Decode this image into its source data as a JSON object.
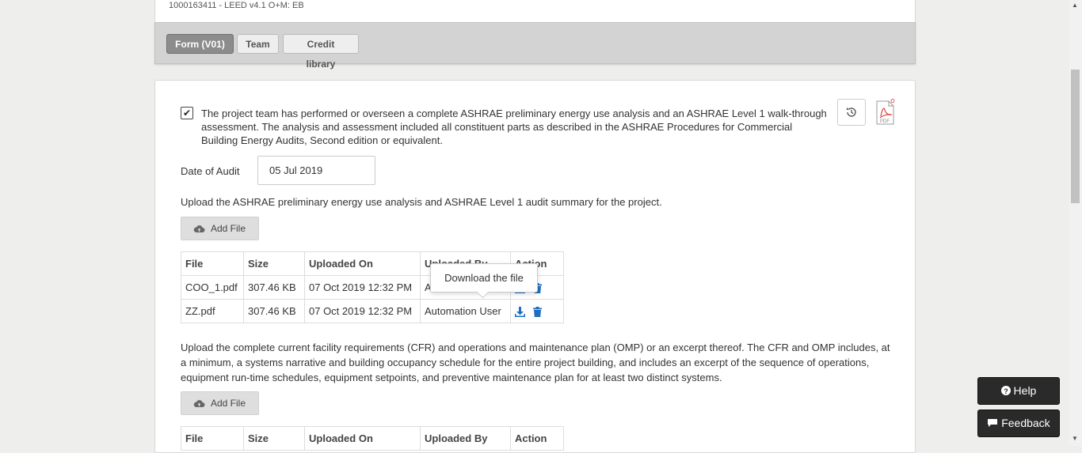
{
  "project": {
    "id_label": "1000163411 - LEED v4.1 O+M: EB"
  },
  "tabs": [
    {
      "label": "Form (V01)",
      "active": true
    },
    {
      "label": "Team",
      "active": false
    },
    {
      "label": "Credit library",
      "active": false
    }
  ],
  "form": {
    "statement": "The project team has performed or overseen a complete ASHRAE preliminary energy use analysis and an ASHRAE Level 1 walk-through assessment. The analysis and assessment included all constituent parts as described in the ASHRAE Procedures for Commercial Building Energy Audits, Second edition or equivalent.",
    "checked": true,
    "date_label": "Date of Audit",
    "date_value": "05 Jul 2019",
    "upload1_text": "Upload the ASHRAE preliminary energy use analysis and ASHRAE Level 1 audit summary for the project.",
    "upload2_text": "Upload the complete current facility requirements (CFR) and operations and maintenance plan (OMP) or an excerpt thereof. The CFR and OMP includes, at a minimum, a systems narrative and building occupancy schedule for the entire project building, and includes an excerpt of the sequence of operations, equipment run-time schedules, equipment setpoints, and preventive maintenance plan for at least two distinct systems.",
    "add_file_label": "Add File",
    "pdf_icon_text": "PDF"
  },
  "table_headers": {
    "file": "File",
    "size": "Size",
    "uploaded_on": "Uploaded On",
    "uploaded_by": "Uploaded By",
    "action": "Action"
  },
  "files1": [
    {
      "file": "COO_1.pdf",
      "size": "307.46 KB",
      "uploaded_on": "07 Oct 2019 12:32 PM",
      "uploaded_by": "Automation User"
    },
    {
      "file": "ZZ.pdf",
      "size": "307.46 KB",
      "uploaded_on": "07 Oct 2019 12:32 PM",
      "uploaded_by": "Automation User"
    }
  ],
  "tooltip": {
    "text": "Download the file"
  },
  "floating": {
    "help_label": "Help",
    "feedback_label": "Feedback"
  },
  "colors": {
    "action_blue": "#1f6fbf",
    "tab_active": "#8c8c8c",
    "float_bg": "#2a2a2a"
  }
}
